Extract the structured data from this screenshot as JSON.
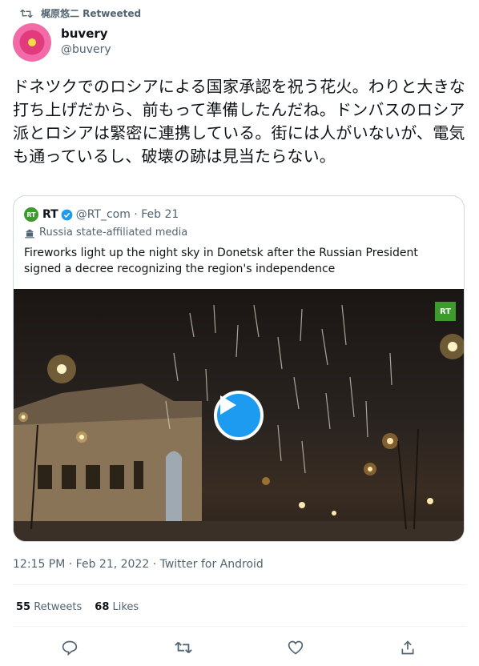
{
  "retweet_header": {
    "text": "梶原悠二 Retweeted",
    "icon": "retweet-icon"
  },
  "author": {
    "display_name": "buvery",
    "handle": "@buvery"
  },
  "tweet": {
    "text": "ドネツクでのロシアによる国家承認を祝う花火。わりと大きな打ち上げだから、前もって準備したんだね。ドンバスのロシア派とロシアは緊密に連携している。街には人がいないが、電気も通っているし、破壊の跡は見当たらない。"
  },
  "quote": {
    "logo_text": "RT",
    "name": "RT",
    "handle_date": "@RT_com · Feb 21",
    "label": "Russia state-affiliated media",
    "text": "Fireworks light up the night sky in Donetsk after the Russian President signed a decree recognizing the region's independence",
    "watermark": "RT",
    "accent": "#1d9bf0"
  },
  "meta": {
    "timestamp": "12:15 PM · Feb 21, 2022 · Twitter for Android"
  },
  "stats": {
    "retweets_count": "55",
    "retweets_label": "Retweets",
    "likes_count": "68",
    "likes_label": "Likes"
  },
  "actions": [
    "reply-icon",
    "retweet-icon",
    "like-icon",
    "share-icon"
  ]
}
